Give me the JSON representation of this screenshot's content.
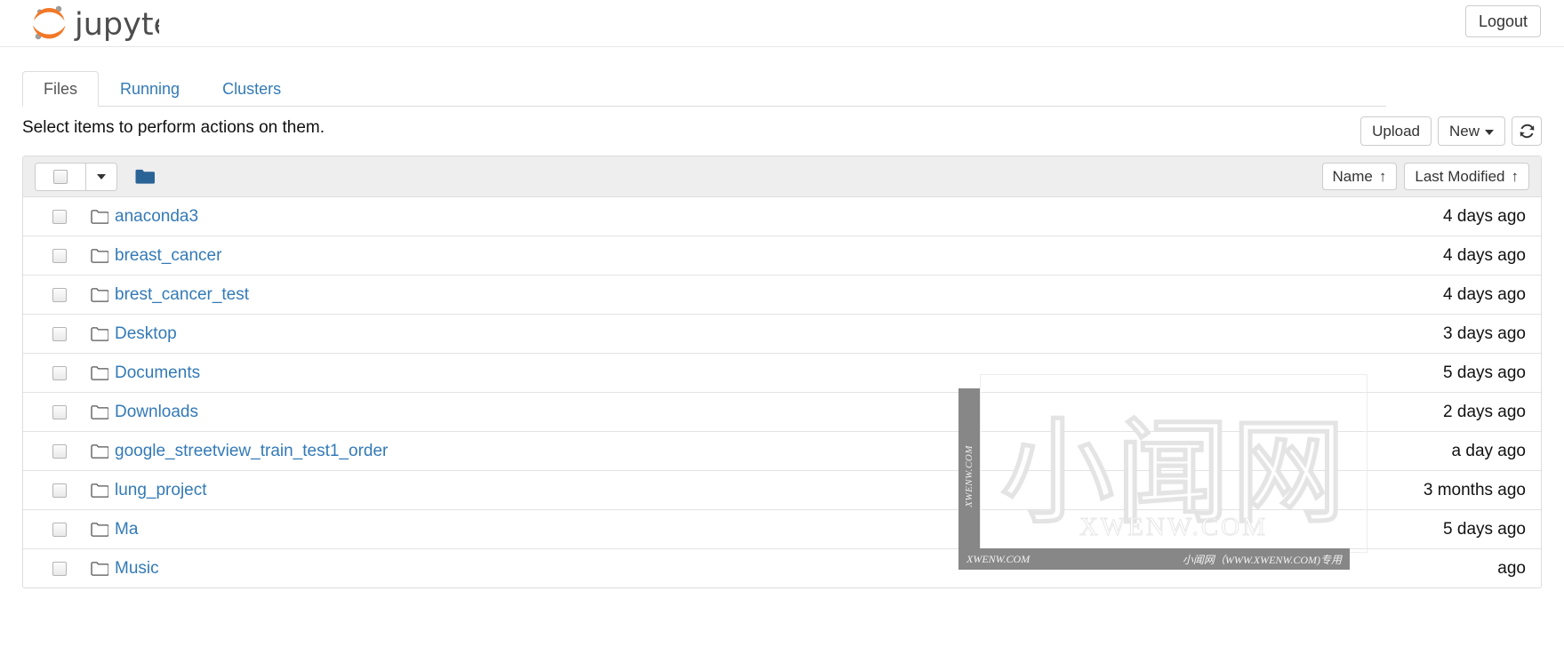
{
  "header": {
    "brand": "jupyter",
    "logout_label": "Logout",
    "logo_icon": "jupyter-logo"
  },
  "tabs": [
    {
      "label": "Files",
      "active": true
    },
    {
      "label": "Running",
      "active": false
    },
    {
      "label": "Clusters",
      "active": false
    }
  ],
  "toolbar": {
    "select_note": "Select items to perform actions on them.",
    "upload_label": "Upload",
    "new_label": "New",
    "refresh_icon": "refresh-icon",
    "caret_icon": "caret-down-icon"
  },
  "list_header": {
    "select_all_checkbox": "",
    "dropdown_icon": "caret-down-icon",
    "folder_icon": "folder-filled-icon",
    "sort_name": "Name",
    "sort_name_arrow": "↑",
    "sort_modified": "Last Modified",
    "sort_modified_arrow": "↑"
  },
  "files": [
    {
      "name": "anaconda3",
      "modified": "4 days ago",
      "icon": "folder-icon"
    },
    {
      "name": "breast_cancer",
      "modified": "4 days ago",
      "icon": "folder-icon"
    },
    {
      "name": "brest_cancer_test",
      "modified": "4 days ago",
      "icon": "folder-icon"
    },
    {
      "name": "Desktop",
      "modified": "3 days ago",
      "icon": "folder-icon"
    },
    {
      "name": "Documents",
      "modified": "5 days ago",
      "icon": "folder-icon"
    },
    {
      "name": "Downloads",
      "modified": "2 days ago",
      "icon": "folder-icon"
    },
    {
      "name": "google_streetview_train_test1_order",
      "modified": "a day ago",
      "icon": "folder-icon"
    },
    {
      "name": "lung_project",
      "modified": "3 months ago",
      "icon": "folder-icon"
    },
    {
      "name": "Ma",
      "modified": "5 days ago",
      "icon": "folder-icon"
    },
    {
      "name": "Music",
      "modified": "ago",
      "icon": "folder-icon"
    }
  ],
  "watermark": {
    "vertical_text": "XWENW.COM",
    "bottom_left_text": "XWENW.COM",
    "bottom_right_text": "小闻网（WWW.XWENW.COM)专用",
    "big_text": "小闻网",
    "mid_text": "XWENW.COM"
  },
  "colors": {
    "link": "#337ab7",
    "logo_orange": "#f37726",
    "logo_gray": "#9e9e9e",
    "header_bg": "#eeeeee",
    "watermark_bar": "#878787"
  }
}
